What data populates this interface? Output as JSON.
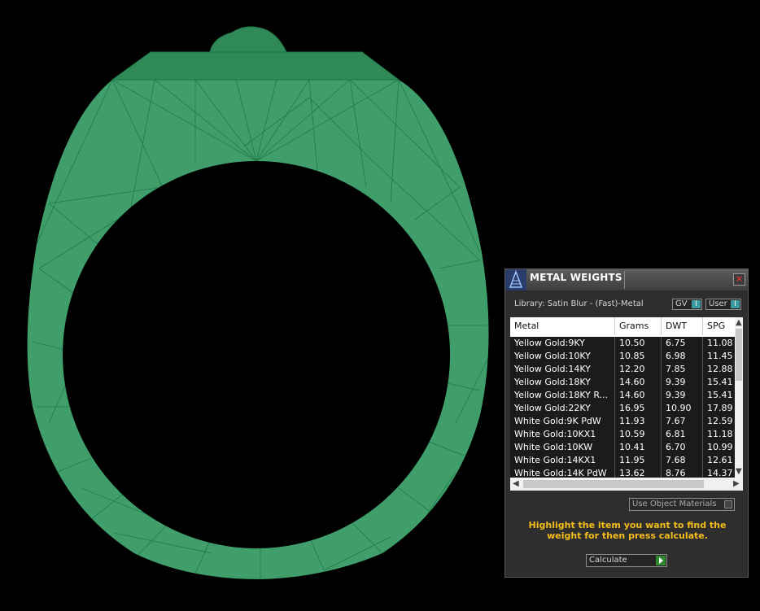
{
  "panel": {
    "title": "METAL WEIGHTS",
    "library_label": "Library: Satin Blur - (Fast)-Metal",
    "toggle_gv": "GV",
    "toggle_user": "User",
    "toggle_knob": "I",
    "close_glyph": "✕",
    "columns": [
      "Metal",
      "Grams",
      "DWT",
      "SPG"
    ],
    "rows": [
      [
        "Yellow Gold:9KY",
        "10.50",
        "6.75",
        "11.08"
      ],
      [
        "Yellow Gold:10KY",
        "10.85",
        "6.98",
        "11.45"
      ],
      [
        "Yellow Gold:14KY",
        "12.20",
        "7.85",
        "12.88"
      ],
      [
        "Yellow Gold:18KY",
        "14.60",
        "9.39",
        "15.41"
      ],
      [
        "Yellow Gold:18KY R...",
        "14.60",
        "9.39",
        "15.41"
      ],
      [
        "Yellow Gold:22KY",
        "16.95",
        "10.90",
        "17.89"
      ],
      [
        "White Gold:9K PdW",
        "11.93",
        "7.67",
        "12.59"
      ],
      [
        "White Gold:10KX1",
        "10.59",
        "6.81",
        "11.18"
      ],
      [
        "White Gold:10KW",
        "10.41",
        "6.70",
        "10.99"
      ],
      [
        "White Gold:14KX1",
        "11.95",
        "7.68",
        "12.61"
      ],
      [
        "White Gold:14K PdW",
        "13.62",
        "8.76",
        "14.37"
      ]
    ],
    "use_object_materials": "Use Object Materials",
    "instruction": "Highlight the item you want to find the weight for then press calculate.",
    "calculate_label": "Calculate"
  },
  "colors": {
    "background": "#000000",
    "ring_fill": "#3f9e6a",
    "ring_wire": "#1f7a47",
    "instruction_text": "#f4bd19",
    "toggle_accent": "#3a9aa0",
    "calc_go": "#2f8a2f"
  },
  "icons": {
    "logo": "tower-logo-icon",
    "close": "close-icon",
    "calculate": "play-arrow-icon"
  }
}
